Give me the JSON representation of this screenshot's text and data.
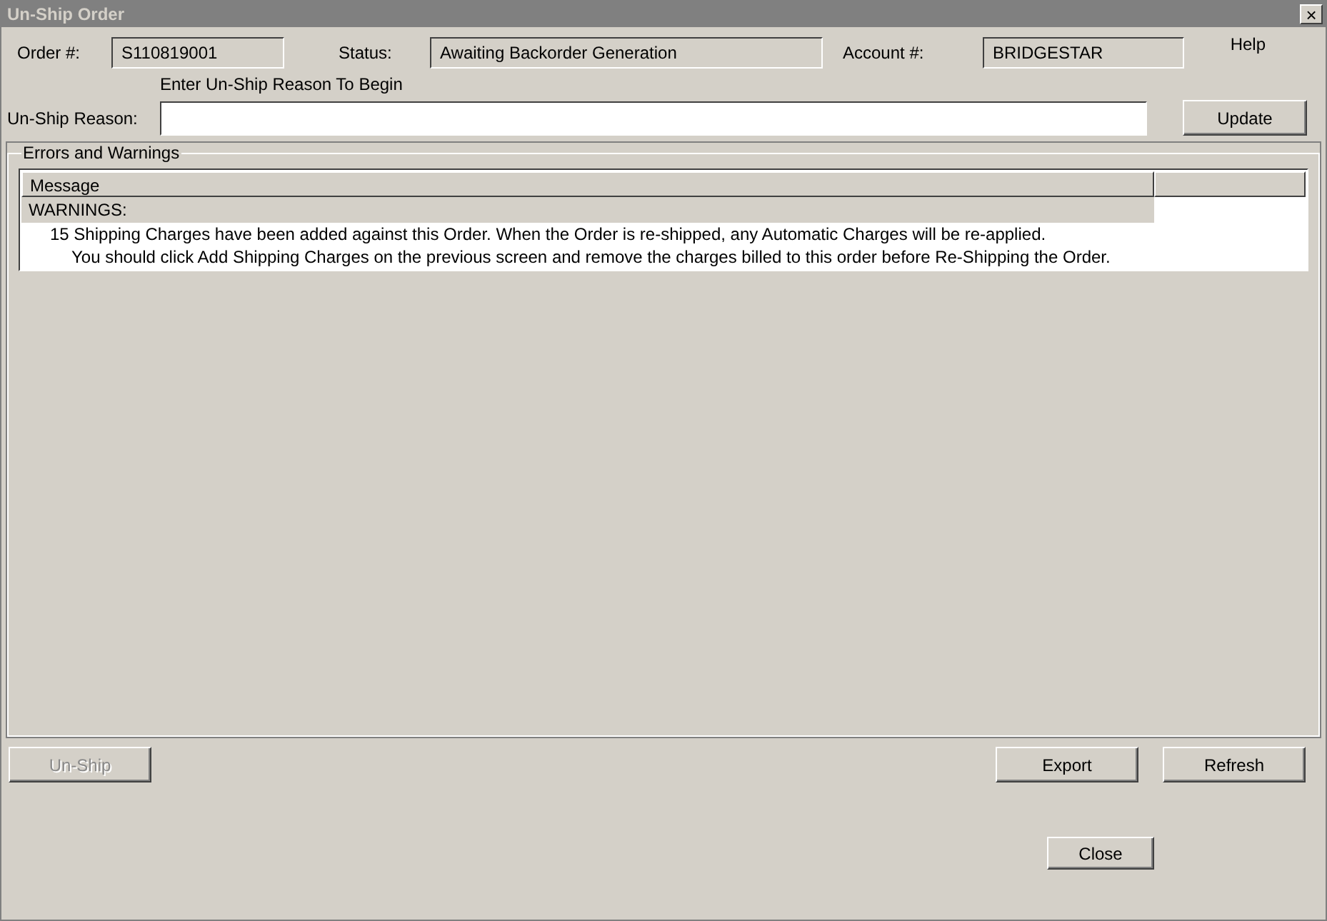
{
  "window": {
    "title": "Un-Ship Order",
    "close": "×"
  },
  "header": {
    "order_label": "Order #:",
    "order_value": "S110819001",
    "status_label": "Status:",
    "status_value": "Awaiting Backorder Generation",
    "account_label": "Account #:",
    "account_value": "BRIDGESTAR",
    "help": "Help"
  },
  "reason": {
    "hint": "Enter Un-Ship Reason To Begin",
    "label": "Un-Ship Reason:",
    "update_button": "Update"
  },
  "errors": {
    "title": "Errors and Warnings",
    "columns": [
      "Message"
    ],
    "rows": [
      {
        "kind": "group",
        "text": "WARNINGS:"
      },
      {
        "kind": "message",
        "lines": [
          "15 Shipping Charges have been added against this Order.  When the Order is re-shipped, any Automatic Charges will be re-applied.",
          "You should click Add Shipping Charges on the previous screen and remove the charges billed to this order before Re-Shipping the Order."
        ]
      }
    ]
  },
  "buttons": [
    {
      "label": "Un-Ship",
      "disabled": true
    },
    {
      "label": "Export",
      "disabled": false
    },
    {
      "label": "Refresh",
      "disabled": false
    }
  ],
  "close_button": "Close"
}
